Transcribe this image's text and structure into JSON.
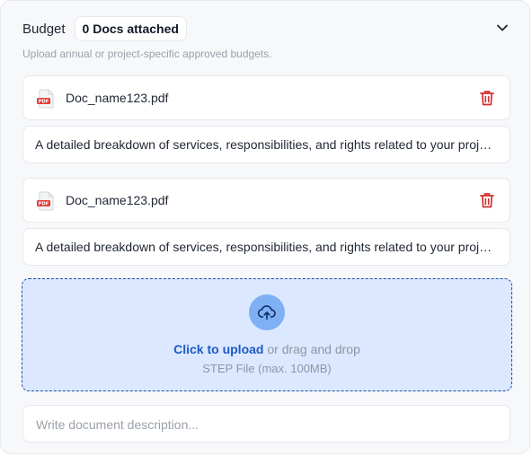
{
  "section": {
    "title": "Budget",
    "badge": "0 Docs attached",
    "subtitle": "Upload annual or project-specific approved budgets.",
    "expand_icon": "chevron-down-icon"
  },
  "documents": [
    {
      "file_name": "Doc_name123.pdf",
      "file_icon": "pdf-file-icon",
      "file_icon_label": "PDF",
      "delete_icon": "trash-icon",
      "description": "A detailed breakdown of services, responsibilities, and rights related to your project."
    },
    {
      "file_name": "Doc_name123.pdf",
      "file_icon": "pdf-file-icon",
      "file_icon_label": "PDF",
      "delete_icon": "trash-icon",
      "description": "A detailed breakdown of services, responsibilities, and rights related to your project."
    }
  ],
  "upload": {
    "icon": "cloud-upload-icon",
    "link_text": "Click to upload",
    "rest_text": " or drag and drop",
    "hint": "STEP File (max. 100MB)"
  },
  "description_input": {
    "value": "",
    "placeholder": "Write document description..."
  },
  "colors": {
    "accent": "#1f5bc4",
    "danger": "#d32f2f",
    "dropzone_bg": "#dbe8ff",
    "upload_circle": "#7fb0f6",
    "panel_bg": "#f7f8fa"
  }
}
